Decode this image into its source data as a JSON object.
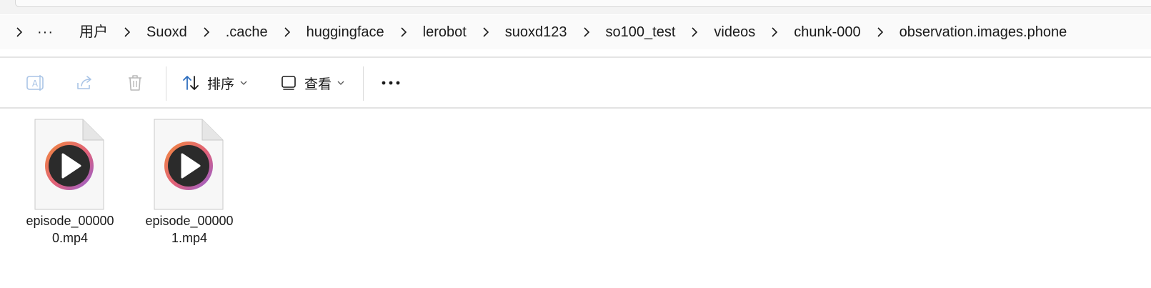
{
  "breadcrumb": {
    "more": "···",
    "items": [
      "用户",
      "Suoxd",
      ".cache",
      "huggingface",
      "lerobot",
      "suoxd123",
      "so100_test",
      "videos",
      "chunk-000",
      "observation.images.phone"
    ]
  },
  "toolbar": {
    "rename_icon": "rename-icon",
    "share_icon": "share-icon",
    "delete_icon": "trash-icon",
    "sort_label": "排序",
    "view_label": "查看",
    "more_icon": "more-horizontal-icon"
  },
  "files": [
    {
      "name_line1": "episode_00000",
      "name_line2": "0.mp4",
      "icon": "video-file-icon"
    },
    {
      "name_line1": "episode_00000",
      "name_line2": "1.mp4",
      "icon": "video-file-icon"
    }
  ],
  "colors": {
    "accent": "#2f6fbf",
    "disabled_icon": "#a9c4e6",
    "play_ring_start": "#f28a3c",
    "play_ring_end": "#8e5fd6",
    "play_disc": "#2b2b2b"
  }
}
